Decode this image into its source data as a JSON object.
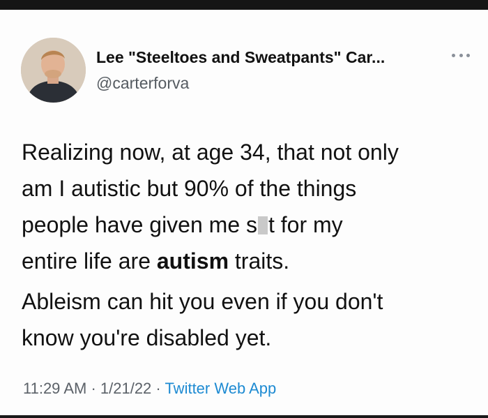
{
  "tweet": {
    "display_name": "Lee \"Steeltoes and Sweatpants\" Car...",
    "handle": "@carterforva",
    "more_icon": "ellipsis-icon",
    "paragraph1": {
      "line1": "Realizing now, at age 34, that not only",
      "line2": "am I autistic but 90% of the things",
      "line3_before": "people have given me s",
      "line3_after": "t for my",
      "line4_before": "entire life are ",
      "line4_bold": "autism",
      "line4_after": " traits."
    },
    "paragraph2": {
      "line1": "Ableism can hit you even if you don't",
      "line2": "know you're disabled yet."
    },
    "time": "11:29 AM",
    "separator1": " · ",
    "date": "1/21/22",
    "separator2": " · ",
    "source": "Twitter Web App"
  },
  "colors": {
    "link": "#1d8ad2",
    "secondary_text": "#555b61",
    "primary_text": "#111111"
  }
}
